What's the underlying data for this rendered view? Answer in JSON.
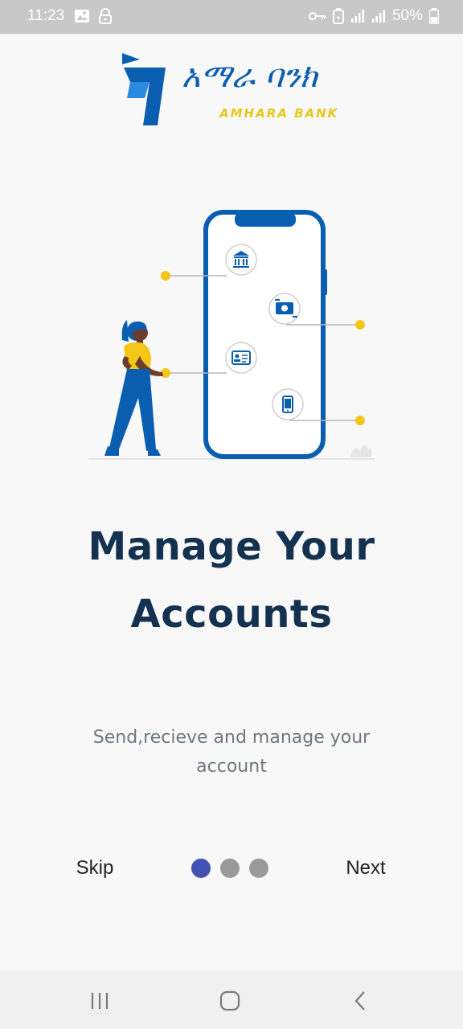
{
  "status_bar": {
    "time": "11:23",
    "battery": "50%",
    "icons": [
      "image-icon",
      "lock-icon",
      "key-icon",
      "battery-saver-icon",
      "signal-icon",
      "signal-icon",
      "battery-icon"
    ]
  },
  "logo": {
    "amharic": "አማራ ባንክ",
    "english": "AMHARA BANK"
  },
  "illustration": {
    "icons": [
      "bank-icon",
      "money-transfer-icon",
      "id-card-icon",
      "mobile-phone-icon"
    ],
    "colors": {
      "phone_frame": "#0a5eb0",
      "accent_dot": "#f5c518",
      "person_shirt": "#f5c518",
      "person_pants": "#0a5eb0"
    }
  },
  "onboarding": {
    "title_line1": "Manage Your",
    "title_line2": "Accounts",
    "subtitle": "Send,recieve and manage your account",
    "skip_label": "Skip",
    "next_label": "Next",
    "current_page": 1,
    "total_pages": 3
  },
  "nav_bar": {
    "buttons": [
      "recent-apps-icon",
      "home-icon",
      "back-icon"
    ]
  },
  "colors": {
    "title": "#143150",
    "subtitle": "#6d7780",
    "active_dot": "#4353b4",
    "inactive_dot": "#9a9a9a"
  }
}
